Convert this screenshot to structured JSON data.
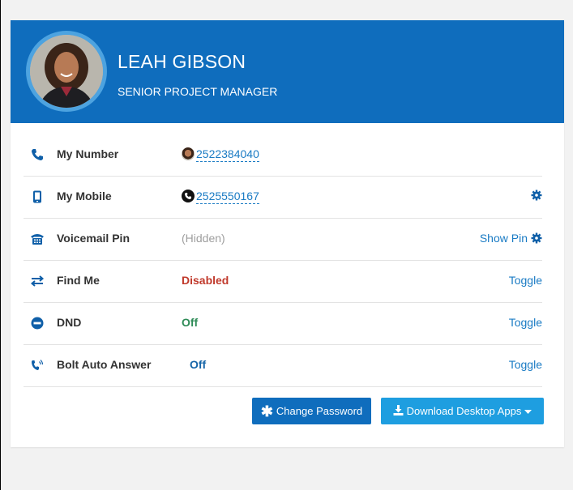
{
  "profile": {
    "name": "LEAH GIBSON",
    "title": "SENIOR PROJECT MANAGER"
  },
  "rows": [
    {
      "label": "My Number",
      "value": "2522384040",
      "icon": "phone-icon"
    },
    {
      "label": "My Mobile",
      "value": "2525550167",
      "icon": "mobile-icon"
    },
    {
      "label": "Voicemail Pin",
      "value": "(Hidden)",
      "action": "Show Pin",
      "icon": "voicemail-icon"
    },
    {
      "label": "Find Me",
      "value": "Disabled",
      "action": "Toggle",
      "icon": "arrows-exchange-icon"
    },
    {
      "label": "DND",
      "value": "Off",
      "action": "Toggle",
      "icon": "minus-circle-icon"
    },
    {
      "label": "Bolt Auto Answer",
      "value": "Off",
      "action": "Toggle",
      "icon": "phone-volume-icon"
    }
  ],
  "buttons": {
    "change_password": "Change Password",
    "download_apps": "Download Desktop Apps"
  },
  "colors": {
    "header_bg": "#0f6dbd",
    "link": "#1a7bc4",
    "disabled_red": "#c0392b",
    "off_green": "#2e8b57",
    "off_blue": "#1565a8"
  }
}
